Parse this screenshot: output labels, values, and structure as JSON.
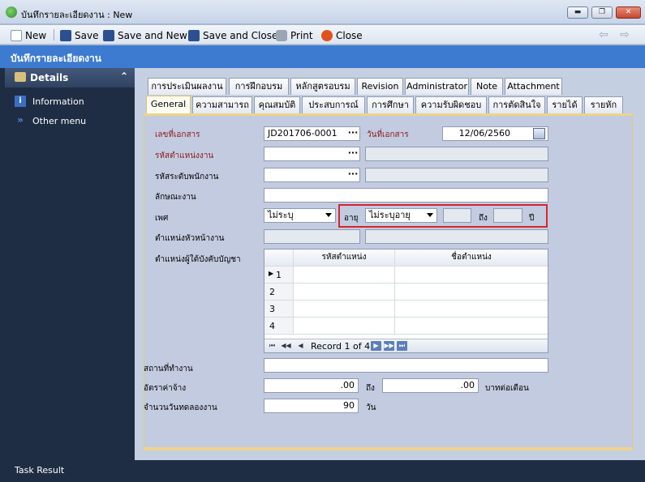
{
  "window": {
    "title": "บันทึกรายละเอียดงาน : New",
    "min_label": "▬",
    "max_label": "❐",
    "close_label": "✕"
  },
  "toolbar": {
    "new_label": "New",
    "save_label": "Save",
    "save_new_label": "Save and New",
    "save_close_label": "Save and Close",
    "print_label": "Print",
    "close_label": "Close",
    "back_label": "⇦",
    "forward_label": "⇨"
  },
  "header": {
    "title": "บันทึกรายละเอียดงาน"
  },
  "sidebar": {
    "section": "Details",
    "collapse_glyph": "⌃",
    "items": [
      {
        "label": "Information",
        "icon": "info-icon"
      },
      {
        "label": "Other menu",
        "icon": "double-chevron-icon"
      }
    ]
  },
  "tabs": {
    "row1": [
      "การประเมินผลงาน",
      "การฝึกอบรม",
      "หลักสูตรอบรม",
      "Revision",
      "Administrator",
      "Note",
      "Attachment"
    ],
    "row2": [
      "General",
      "ความสามารถ",
      "คุณสมบัติ",
      "ประสบการณ์",
      "การศึกษา",
      "ความรับผิดชอบ",
      "การตัดสินใจ",
      "รายได้",
      "รายหัก"
    ],
    "active": "General"
  },
  "form": {
    "doc_no_label": "เลขที่เอกสาร",
    "doc_no_value": "JD201706-0001",
    "doc_date_label": "วันที่เอกสาร",
    "doc_date_value": "12/06/2560",
    "position_code_label": "รหัสตำแหน่งงาน",
    "level_code_label": "รหัสระดับพนักงาน",
    "job_type_label": "ลักษณะงาน",
    "gender_label": "เพศ",
    "gender_value": "ไม่ระบุ",
    "age_label": "อายุ",
    "age_value": "ไม่ระบุอายุ",
    "age_to_label": "ถึง",
    "year_label": "ปี",
    "supervisor_label": "ตำแหน่งหัวหน้างาน",
    "subordinate_label": "ตำแหน่งผู้ใต้บังคับบัญชา",
    "workplace_label": "สถานที่ทำงาน",
    "salary_label": "อัตราค่าจ้าง",
    "salary_from": ".00",
    "salary_to_label": "ถึง",
    "salary_to": ".00",
    "salary_unit": "บาทต่อเดือน",
    "probation_label": "จำนวนวันทดลองงาน",
    "probation_value": "90",
    "probation_unit": "วัน",
    "dots": "···"
  },
  "grid": {
    "columns": [
      "รหัสตำแหน่ง",
      "ชื่อตำแหน่ง"
    ],
    "rows": [
      "1",
      "2",
      "3",
      "4"
    ],
    "record_text": "Record 1 of 4"
  },
  "footer": {
    "text": "Task Result"
  }
}
